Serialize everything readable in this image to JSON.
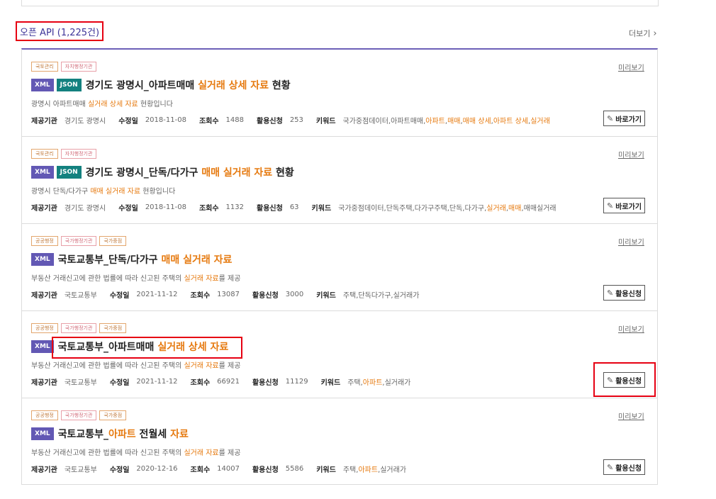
{
  "section": {
    "title": "오픈 API (1,225건)",
    "more_label": "더보기",
    "more_icon": "chevron-right-icon"
  },
  "labels": {
    "provider": "제공기관",
    "modified": "수정일",
    "views": "조회수",
    "requests": "활용신청",
    "keywords": "키워드",
    "preview": "미리보기"
  },
  "items": [
    {
      "tags": [
        "국토관리",
        "자치행정기관"
      ],
      "formats": [
        "XML",
        "JSON"
      ],
      "title_parts": [
        "경기도 광명시_아파트매매 ",
        "실거래 상세 자료",
        " 현황"
      ],
      "desc_parts": [
        "광명시 아파트매매 ",
        "실거래 상세 자료",
        " 현황입니다"
      ],
      "provider": "경기도 광명시",
      "modified": "2018-11-08",
      "views": "1488",
      "requests": "253",
      "keywords_parts": [
        "국가중점데이터,아파트매매,",
        "아파트",
        ",",
        "매매",
        ",",
        "매매 상세",
        ",",
        "아파트 상세",
        ",",
        "실거래"
      ],
      "action": "바로가기"
    },
    {
      "tags": [
        "국토관리",
        "자치행정기관"
      ],
      "formats": [
        "XML",
        "JSON"
      ],
      "title_parts": [
        "경기도 광명시_단독/다가구 ",
        "매매 실거래 자료",
        " 현황"
      ],
      "desc_parts": [
        "광명시 단독/다가구 ",
        "매매 실거래 자료",
        " 현황입니다"
      ],
      "provider": "경기도 광명시",
      "modified": "2018-11-08",
      "views": "1132",
      "requests": "63",
      "keywords_parts": [
        "국가중점데이터,단독주택,다가구주택,단독,다가구,",
        "실거래",
        ",",
        "매매",
        ",매매실거래"
      ],
      "action": "바로가기"
    },
    {
      "tags": [
        "공공행정",
        "국가행정기관",
        "국가중점"
      ],
      "formats": [
        "XML"
      ],
      "title_parts": [
        "국토교통부_단독/다가구 ",
        "매매 실거래 자료",
        ""
      ],
      "desc_parts": [
        "부동산 거래신고에 관한 법률에 따라 신고된 주택의 ",
        "실거래 자료",
        "를 제공"
      ],
      "provider": "국토교통부",
      "modified": "2021-11-12",
      "views": "13087",
      "requests": "3000",
      "keywords_parts": [
        "주택,단독다가구,실거래가"
      ],
      "action": "활용신청"
    },
    {
      "tags": [
        "공공행정",
        "국가행정기관",
        "국가중점"
      ],
      "formats": [
        "XML"
      ],
      "title_parts": [
        "국토교통부_아파트매매 ",
        "실거래 상세 자료",
        ""
      ],
      "desc_parts": [
        "부동산 거래신고에 관한 법률에 따라 신고된 주택의 ",
        "실거래 자료",
        "를 제공"
      ],
      "provider": "국토교통부",
      "modified": "2021-11-12",
      "views": "66921",
      "requests": "11129",
      "keywords_parts": [
        "주택,",
        "아파트",
        ",실거래가"
      ],
      "action": "활용신청"
    },
    {
      "tags": [
        "공공행정",
        "국가행정기관",
        "국가중점"
      ],
      "formats": [
        "XML"
      ],
      "title_parts": [
        "국토교통부_",
        "아파트",
        " 전월세 ",
        "자료"
      ],
      "desc_parts": [
        "부동산 거래신고에 관한 법률에 따라 신고된 주택의 ",
        "실거래 자료",
        "를 제공"
      ],
      "provider": "국토교통부",
      "modified": "2020-12-16",
      "views": "14007",
      "requests": "5586",
      "keywords_parts": [
        "주택,",
        "아파트",
        ",실거래가"
      ],
      "action": "활용신청"
    }
  ]
}
